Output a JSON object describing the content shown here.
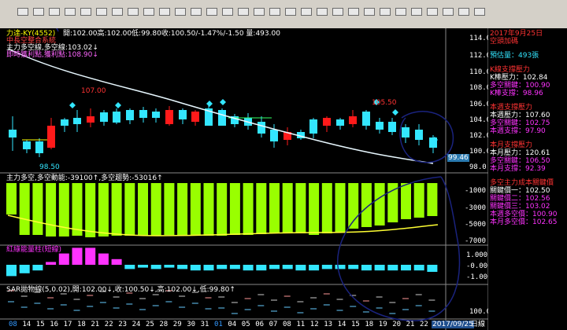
{
  "header": {
    "title": "力達-KY(4552)",
    "ohlc": "開:102.00高:102.00低:99.80收:100.50/-1.47%/-1.50 量:493.00",
    "line2": "中長空整合系統",
    "line3": "主力多空線,多空線:103.02↓",
    "line4": "即時獲利點,獲利點:108.90↓"
  },
  "price_panel": {
    "high_label": "107.00",
    "high2_label": "105.50",
    "low_label": "98.50",
    "current_label": "99.46",
    "ticks": [
      "114.0",
      "112.0",
      "110.0",
      "108.0",
      "106.0",
      "104.0",
      "102.0",
      "100.0",
      "98.0"
    ]
  },
  "volume_panel": {
    "title": "主力多空,多空動能:-39100↑,多空趨勢:-53016↑",
    "ticks": [
      "-1000",
      "-3000",
      "-5000",
      "-7000"
    ]
  },
  "osc_panel": {
    "title": "紅綠能量柱(短線)",
    "ticks": [
      "1.000",
      "-0.000",
      "-1.000"
    ]
  },
  "sar_panel": {
    "title": "SAR拋物線(5,0.02),開:102.00↓,收:100.50↓,高:102.00↓,低:99.80↑",
    "ticks": [
      "100.0"
    ]
  },
  "xaxis": {
    "labels": [
      "08",
      "14",
      "15",
      "16",
      "17",
      "18",
      "21",
      "22",
      "23",
      "24",
      "25",
      "28",
      "29",
      "30",
      "31",
      "01",
      "04",
      "05",
      "06",
      "07",
      "08",
      "11",
      "12",
      "13",
      "14",
      "15",
      "18",
      "19",
      "20",
      "21",
      "22"
    ],
    "date_label": "2017/09/25",
    "suffix": "日線"
  },
  "side": {
    "date": "2017年9月25日",
    "trend": "空頭加碼",
    "estimate": "預估量：493張",
    "k_title": "K線支撐壓力",
    "k_pressure": "K棒壓力：102.84",
    "k_ls": "多空關鍵：100.90",
    "k_support": "K棒支撐：98.96",
    "w_title": "本週支撐壓力",
    "w_pressure": "本週壓力：107.60",
    "w_ls": "多空關鍵：102.75",
    "w_support": "本週支撐：97.90",
    "m_title": "本月支撐壓力",
    "m_pressure": "本月壓力：120.61",
    "m_ls": "多空關鍵：106.50",
    "m_support": "本月支撐：92.39",
    "c_title": "多空主力成本關鍵價",
    "c1": "關鍵價一：102.50",
    "c2": "關鍵價二：102.56",
    "c3": "關鍵價三：103.02",
    "c4": "本週多空價：100.90",
    "c5": "本月多空價：102.65"
  },
  "colors": {
    "up": "#ff1a1a",
    "down": "#33e6ff",
    "volume": "#99ff00",
    "ma": "#e8f8ff",
    "yellow": "#ffff33",
    "magenta": "#ff33ff",
    "annotation": "#1a237e"
  }
}
